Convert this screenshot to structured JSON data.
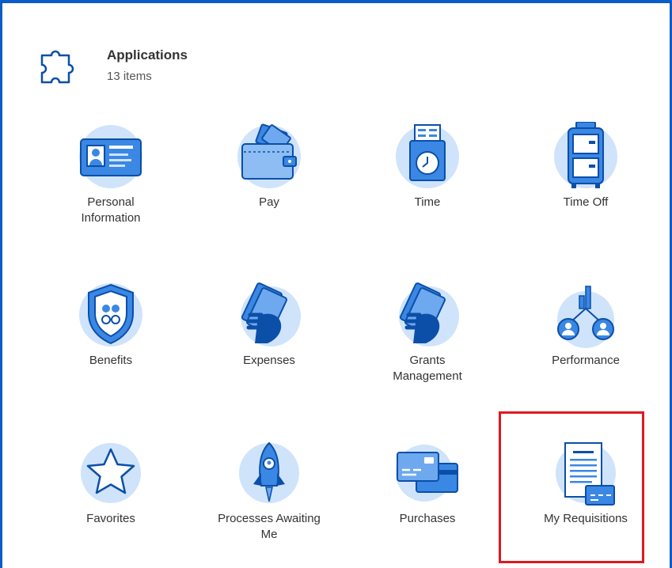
{
  "header": {
    "title": "Applications",
    "count": "13 items"
  },
  "apps": [
    {
      "label": "Personal Information",
      "icon": "id-card-icon"
    },
    {
      "label": "Pay",
      "icon": "wallet-icon"
    },
    {
      "label": "Time",
      "icon": "time-clock-icon"
    },
    {
      "label": "Time Off",
      "icon": "suitcase-icon"
    },
    {
      "label": "Benefits",
      "icon": "shield-icon"
    },
    {
      "label": "Expenses",
      "icon": "hand-money-icon"
    },
    {
      "label": "Grants Management",
      "icon": "hand-money-icon"
    },
    {
      "label": "Performance",
      "icon": "performance-chart-icon"
    },
    {
      "label": "Favorites",
      "icon": "star-icon"
    },
    {
      "label": "Processes Awaiting Me",
      "icon": "rocket-icon"
    },
    {
      "label": "Purchases",
      "icon": "credit-cards-icon"
    },
    {
      "label": "My Requisitions",
      "icon": "requisition-document-icon"
    }
  ],
  "colors": {
    "accent_border": "#0a5cc6",
    "icon_circle": "#cfe3fb",
    "icon_fill": "#3b87e4",
    "icon_stroke": "#0b4fa8",
    "highlight": "#e0191e"
  }
}
